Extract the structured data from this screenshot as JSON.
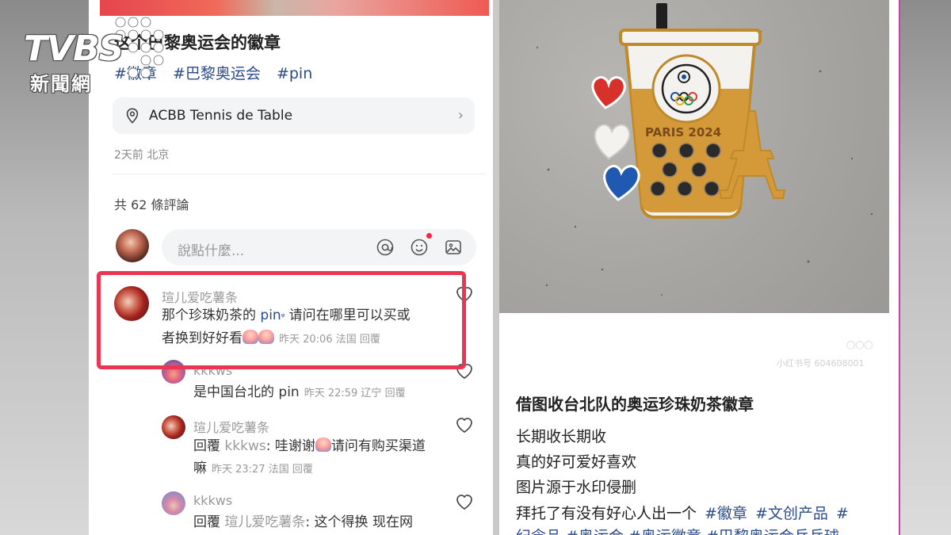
{
  "left": {
    "post_title": "这个巴黎奥运会的徽章",
    "tags": [
      "#徽章",
      "#巴黎奥运会",
      "#pin"
    ],
    "location": "ACBB Tennis de Table",
    "meta": "2天前 北京",
    "comment_count": "共 62 條評論",
    "input_placeholder": "說點什麼...",
    "comments": [
      {
        "user": "瑄儿爱吃薯条",
        "line1_pre": "那个珍珠奶茶的 ",
        "line1_link": "pin",
        "line1_post": " 请问在哪里可以买或",
        "line2": "者换到好好看",
        "meta": "昨天 20:06 法国 回覆"
      },
      {
        "user": "kkkws",
        "text": "是中国台北的 pin",
        "meta": "昨天 22:59 辽宁 回覆"
      },
      {
        "user": "瑄儿爱吃薯条",
        "line1_reply": "回覆 ",
        "line1_ref": "kkkws",
        "line1_post": ": 哇谢谢",
        "line1_tail": "请问有购买渠道",
        "line2": "嘛",
        "meta": "昨天 23:27 法国 回覆"
      },
      {
        "user": "kkkws",
        "line1_reply": "回覆 ",
        "line1_ref": "瑄儿爱吃薯条",
        "line1_post": ": 这个得换 现在网"
      }
    ]
  },
  "right": {
    "pin_text": "PARIS 2024",
    "watermark": "小红书号 604608001",
    "title": "借图收台北队的奥运珍珠奶茶徽章",
    "lines": [
      "长期收长期收",
      "真的好可爱好喜欢",
      "图片源于水印侵删"
    ],
    "last_line_text": "拜托了有没有好心人出一个",
    "last_line_tags": [
      "#徽章",
      "#文创产品",
      "#"
    ],
    "bottom_tags": "纪念品 #奥运会 #奥运徽章 #巴黎奥运会乒乓球"
  },
  "logo": {
    "brand": "TVBS",
    "sub": "新聞網"
  },
  "colors": {
    "accent_red": "#ea3652",
    "link_blue": "#2b4c8c",
    "muted_gray": "#999999"
  },
  "icons": [
    "location-pin-icon",
    "chevron-right-icon",
    "at-icon",
    "emoji-icon",
    "image-icon",
    "heart-icon"
  ]
}
